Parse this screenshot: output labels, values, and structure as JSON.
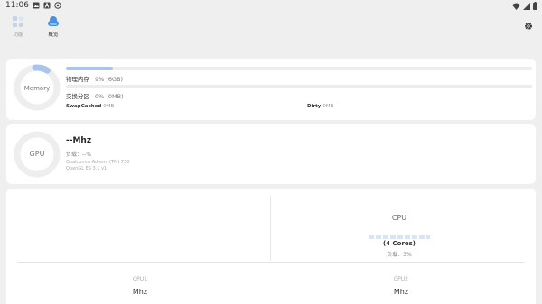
{
  "status_bar": {
    "time": "11:06",
    "notification_icons": [
      "image-icon",
      "a-badge-icon",
      "circle-icon"
    ],
    "system_icons": [
      "wifi-icon",
      "signal-icon",
      "battery-icon"
    ]
  },
  "nav": {
    "tabs": [
      {
        "label": "功能",
        "icon": "apps-icon",
        "active": false
      },
      {
        "label": "概览",
        "icon": "cloud-icon",
        "active": true
      }
    ],
    "settings_icon": "gear-icon"
  },
  "memory": {
    "ring_label": "Memory",
    "accent": "#a9c5ec",
    "physical": {
      "label": "物理内存",
      "value": "9% (6GB)",
      "fraction": 0.1
    },
    "swap": {
      "label": "交换分区",
      "value": "0% (0MB)",
      "fraction": 0.0
    },
    "swap_cached": {
      "label": "SwapCached",
      "value": "0MB"
    },
    "dirty": {
      "label": "Dirty",
      "value": "0MB"
    }
  },
  "gpu": {
    "ring_label": "GPU",
    "freq": "--Mhz",
    "load": "负载：--%",
    "renderer": "Qualcomm Adreno (TM) 730",
    "api": "OpenGL ES 3.1 v1"
  },
  "cpu": {
    "title": "CPU",
    "cores": "(4 Cores)",
    "load": "负载：3%",
    "core_list": [
      {
        "name": "CPU1",
        "freq": "Mhz"
      },
      {
        "name": "CPU2",
        "freq": "Mhz"
      }
    ]
  }
}
